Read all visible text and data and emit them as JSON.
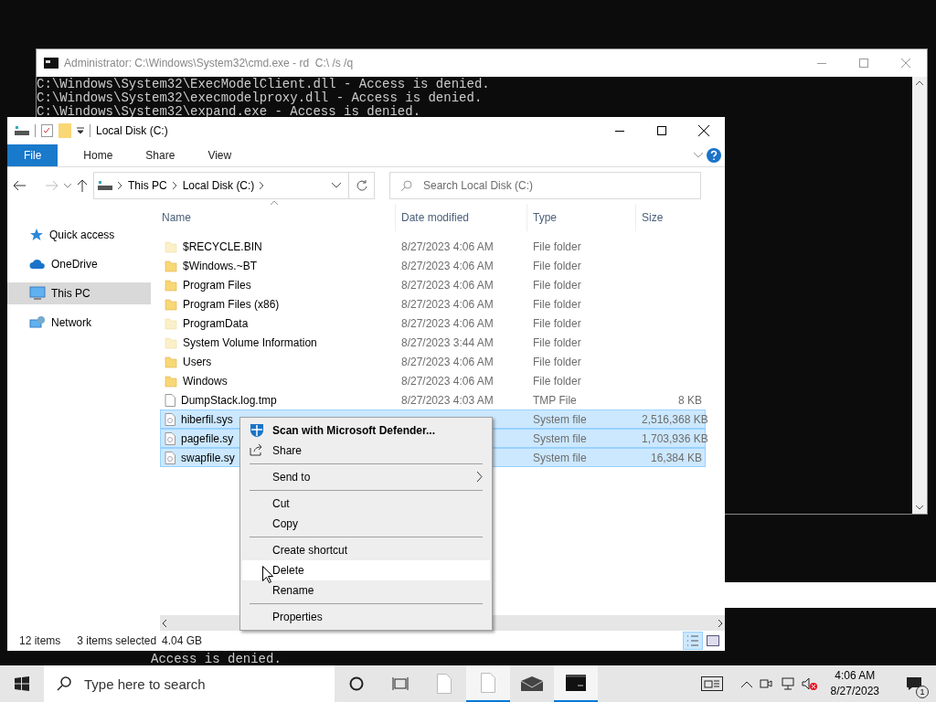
{
  "console_window": {
    "title": "Administrator: C:\\Windows\\System32\\cmd.exe - rd  C:\\ /s /q",
    "lines": [
      "C:\\Windows\\System32\\ExecModelClient.dll - Access is denied.",
      "C:\\Windows\\System32\\execmodelproxy.dll - Access is denied.",
      "C:\\Windows\\System32\\expand.exe - Access is denied."
    ]
  },
  "background_console": {
    "lines": [
      "Access is denied."
    ]
  },
  "explorer": {
    "title": "Local Disk (C:)",
    "ribbon_tabs": [
      {
        "label": "File",
        "kind": "file"
      },
      {
        "label": "Home",
        "kind": "tab"
      },
      {
        "label": "Share",
        "kind": "tab"
      },
      {
        "label": "View",
        "kind": "tab"
      }
    ],
    "address": {
      "crumbs": [
        "This PC",
        "Local Disk (C:)"
      ]
    },
    "search": {
      "placeholder": "Search Local Disk (C:)"
    },
    "nav": [
      {
        "label": "Quick access",
        "kind": "star",
        "selected": false
      },
      {
        "label": "OneDrive",
        "kind": "cloud",
        "selected": false
      },
      {
        "label": "This PC",
        "kind": "pc",
        "selected": true
      },
      {
        "label": "Network",
        "kind": "network",
        "selected": false
      }
    ],
    "columns": [
      "Name",
      "Date modified",
      "Type",
      "Size"
    ],
    "rows": [
      {
        "name": "$RECYCLE.BIN",
        "date": "8/27/2023 4:06 AM",
        "type": "File folder",
        "kind": "hidden-folder",
        "selected": false
      },
      {
        "name": "$Windows.~BT",
        "date": "8/27/2023 4:06 AM",
        "type": "File folder",
        "kind": "folder",
        "selected": false
      },
      {
        "name": "Program Files",
        "date": "8/27/2023 4:06 AM",
        "type": "File folder",
        "kind": "folder",
        "selected": false
      },
      {
        "name": "Program Files (x86)",
        "date": "8/27/2023 4:06 AM",
        "type": "File folder",
        "kind": "folder",
        "selected": false
      },
      {
        "name": "ProgramData",
        "date": "8/27/2023 4:06 AM",
        "type": "File folder",
        "kind": "hidden-folder",
        "selected": false
      },
      {
        "name": "System Volume Information",
        "date": "8/27/2023 3:44 AM",
        "type": "File folder",
        "kind": "hidden-folder",
        "selected": false
      },
      {
        "name": "Users",
        "date": "8/27/2023 4:06 AM",
        "type": "File folder",
        "kind": "folder",
        "selected": false
      },
      {
        "name": "Windows",
        "date": "8/27/2023 4:06 AM",
        "type": "File folder",
        "kind": "folder",
        "selected": false
      },
      {
        "name": "DumpStack.log.tmp",
        "date": "8/27/2023 4:03 AM",
        "type": "TMP File",
        "size": "8 KB",
        "kind": "file",
        "selected": false
      },
      {
        "name": "hiberfil.sys",
        "type": "System file",
        "size": "2,516,368 KB",
        "kind": "system-file",
        "selected": true
      },
      {
        "name": "pagefile.sy",
        "type": "System file",
        "size": "1,703,936 KB",
        "kind": "system-file",
        "selected": true
      },
      {
        "name": "swapfile.sy",
        "type": "System file",
        "size": "16,384 KB",
        "kind": "system-file",
        "selected": true
      }
    ],
    "status": {
      "count": "12 items",
      "selection": "3 items selected",
      "selection_size": "4.04 GB"
    }
  },
  "context_menu": {
    "groups": [
      [
        {
          "label": "Scan with Microsoft Defender...",
          "kind": "defender",
          "bold": true,
          "submenu": false,
          "highlighted": false
        },
        {
          "label": "Share",
          "kind": "share",
          "bold": false,
          "submenu": false,
          "highlighted": false
        }
      ],
      [
        {
          "label": "Send to",
          "kind": "plain",
          "bold": false,
          "submenu": true,
          "highlighted": false
        }
      ],
      [
        {
          "label": "Cut",
          "kind": "plain",
          "bold": false,
          "submenu": false,
          "highlighted": false
        },
        {
          "label": "Copy",
          "kind": "plain",
          "bold": false,
          "submenu": false,
          "highlighted": false
        }
      ],
      [
        {
          "label": "Create shortcut",
          "kind": "plain",
          "bold": false,
          "submenu": false,
          "highlighted": false
        },
        {
          "label": "Delete",
          "kind": "plain",
          "bold": false,
          "submenu": false,
          "highlighted": true
        },
        {
          "label": "Rename",
          "kind": "plain",
          "bold": false,
          "submenu": false,
          "highlighted": false
        }
      ],
      [
        {
          "label": "Properties",
          "kind": "plain",
          "bold": false,
          "submenu": false,
          "highlighted": false
        }
      ]
    ]
  },
  "taskbar": {
    "search": {
      "placeholder": "Type here to search"
    },
    "apps": [
      {
        "kind": "document",
        "active": false
      },
      {
        "kind": "document",
        "active": true
      },
      {
        "kind": "mail",
        "active": false
      },
      {
        "kind": "console",
        "active": true
      }
    ],
    "clock": {
      "time": "4:06 AM",
      "date": "8/27/2023"
    },
    "notification_count": "1"
  }
}
